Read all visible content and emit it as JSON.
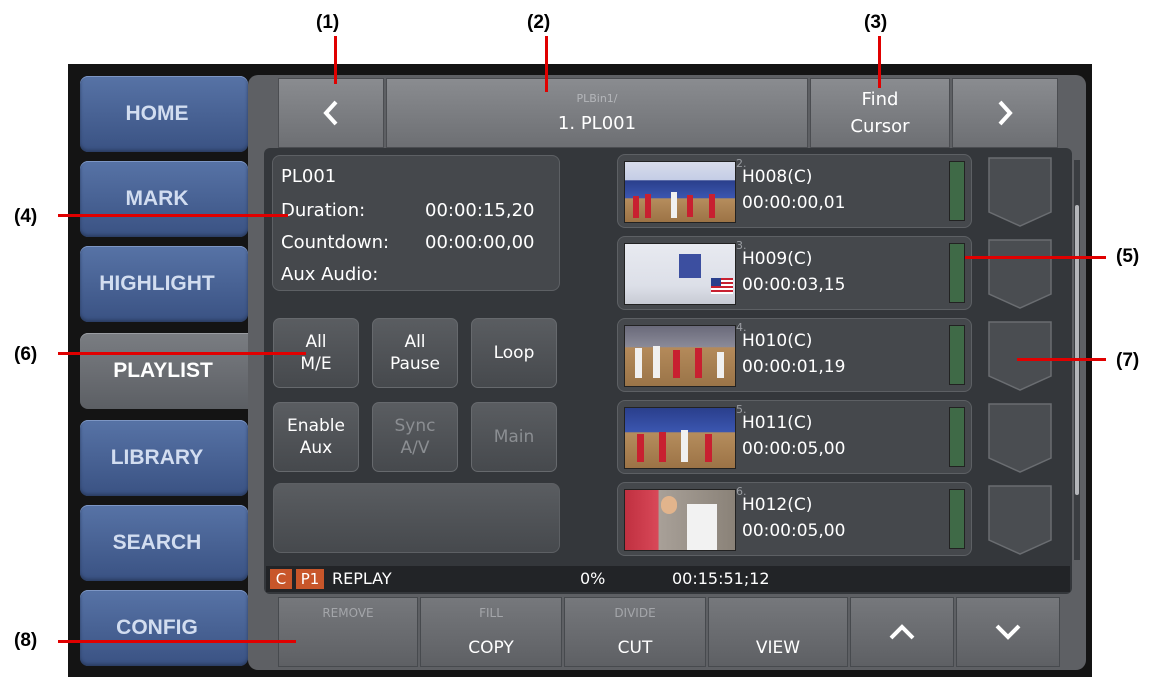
{
  "callouts": [
    "(1)",
    "(2)",
    "(3)",
    "(4)",
    "(5)",
    "(6)",
    "(7)",
    "(8)"
  ],
  "sidebar": {
    "items": [
      {
        "label": "HOME"
      },
      {
        "label": "MARK"
      },
      {
        "label": "HIGHLIGHT"
      },
      {
        "label": "PLAYLIST",
        "active": true
      },
      {
        "label": "LIBRARY"
      },
      {
        "label": "SEARCH"
      },
      {
        "label": "CONFIG"
      }
    ]
  },
  "header": {
    "prev_icon": "chevron-left",
    "path": "PLBin1/",
    "title": "1. PL001",
    "find_cursor": "Find\nCursor",
    "next_icon": "chevron-right"
  },
  "info": {
    "name": "PL001",
    "duration_label": "Duration:",
    "duration_value": "00:00:15,20",
    "countdown_label": "Countdown:",
    "countdown_value": "00:00:00,00",
    "aux_audio_label": "Aux Audio:"
  },
  "controls": [
    {
      "label": "All\nM/E",
      "enabled": true
    },
    {
      "label": "All\nPause",
      "enabled": true
    },
    {
      "label": "Loop",
      "enabled": true
    },
    {
      "label": "Enable\nAux",
      "enabled": true
    },
    {
      "label": "Sync\nA/V",
      "enabled": false
    },
    {
      "label": "Main",
      "enabled": false
    }
  ],
  "clips": [
    {
      "index": "2.",
      "name": "H008(C)",
      "time": "00:00:00,01"
    },
    {
      "index": "3.",
      "name": "H009(C)",
      "time": "00:00:03,15"
    },
    {
      "index": "4.",
      "name": "H010(C)",
      "time": "00:00:01,19"
    },
    {
      "index": "5.",
      "name": "H011(C)",
      "time": "00:00:05,00"
    },
    {
      "index": "6.",
      "name": "H012(C)",
      "time": "00:00:05,00"
    }
  ],
  "status": {
    "badge_c": "C",
    "badge_p": "P1",
    "mode": "REPLAY",
    "percent": "0%",
    "timecode": "00:15:51;12"
  },
  "footer": {
    "remove": "REMOVE",
    "fill": "FILL",
    "copy": "COPY",
    "divide": "DIVIDE",
    "cut": "CUT",
    "view": "VIEW",
    "up_icon": "chevron-up",
    "down_icon": "chevron-down"
  },
  "colors": {
    "tab_blue": "#4a6396",
    "panel_gray": "#5e6064",
    "meter_green": "#3f6a47",
    "badge_orange": "#c8562a",
    "callout_red": "#e00000"
  }
}
